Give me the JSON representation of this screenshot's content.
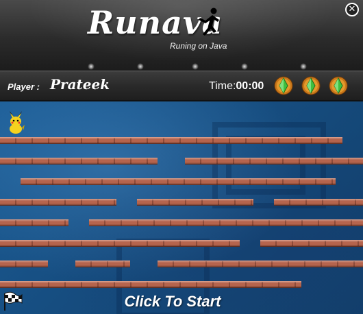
{
  "header": {
    "title": "Runava",
    "tagline": "Runing on Java",
    "close_symbol": "✕"
  },
  "status": {
    "player_label": "Player :",
    "player_name": "Prateek",
    "time_label": "Time:",
    "time_value": "00:00",
    "lives": 3,
    "life_icon": "green-diamond-on-orange-orb"
  },
  "game": {
    "start_label": "Click To Start",
    "player_character": "pikachu",
    "goal_icon": "checkered-flag",
    "colors": {
      "background": "#1b5c95",
      "brick": "#b5644d"
    }
  }
}
